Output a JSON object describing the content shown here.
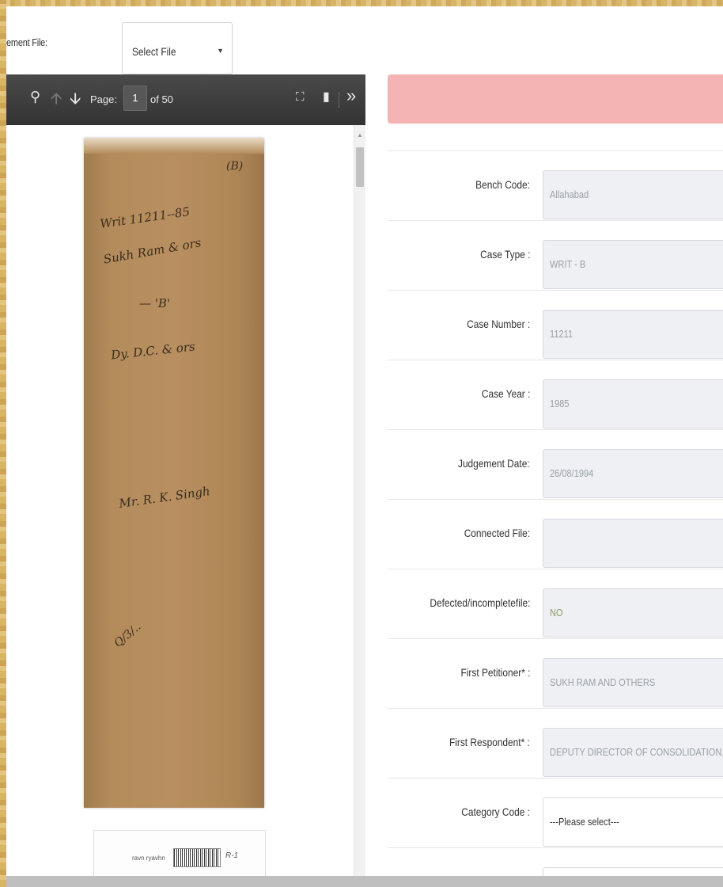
{
  "top": {
    "file_label": "ement File:",
    "select_file": "Select File"
  },
  "viewer": {
    "page_label": "Page:",
    "page_current": "1",
    "page_of": "of 50",
    "handwriting": [
      "Writ 11211--85",
      "Sukh Ram & ors",
      "— 'B'",
      "Dy. D.C. & ors",
      "Mr. R. K. Singh",
      "Q/3/..",
      "(B)"
    ],
    "doc2_text": "ravn ryavhn",
    "doc2_mark": "R-1"
  },
  "form": {
    "fields": [
      {
        "label": "Bench Code:",
        "value": "Allahabad",
        "type": "readonly"
      },
      {
        "label": "Case Type :",
        "value": "WRIT - B",
        "type": "readonly"
      },
      {
        "label": "Case Number :",
        "value": "11211",
        "type": "readonly"
      },
      {
        "label": "Case Year :",
        "value": "1985",
        "type": "readonly"
      },
      {
        "label": "Judgement Date:",
        "value": "26/08/1994",
        "type": "readonly"
      },
      {
        "label": "Connected File:",
        "value": "",
        "type": "readonly"
      },
      {
        "label": "Defected/incompletefile:",
        "value": "NO",
        "type": "readonly-green"
      },
      {
        "label": "First Petitioner* :",
        "value": "SUKH RAM AND OTHERS",
        "type": "readonly"
      },
      {
        "label": "First Respondent* :",
        "value": "DEPUTY DIRECTOR OF CONSOLIDATION, D",
        "type": "readonly"
      },
      {
        "label": "Category Code :",
        "value": "---Please select---",
        "type": "select"
      }
    ]
  },
  "icons": {
    "search": "search-icon",
    "prev": "arrow-up-icon",
    "next": "arrow-down-icon",
    "fullscreen": "fullscreen-icon",
    "bookmark": "bookmark-icon",
    "more": "double-chevron-right-icon",
    "dropdown": "caret-down-icon"
  },
  "colors": {
    "alert": "#f4b4b4",
    "toolbar": "#3a3a3a",
    "field_bg": "#eef0f3"
  }
}
